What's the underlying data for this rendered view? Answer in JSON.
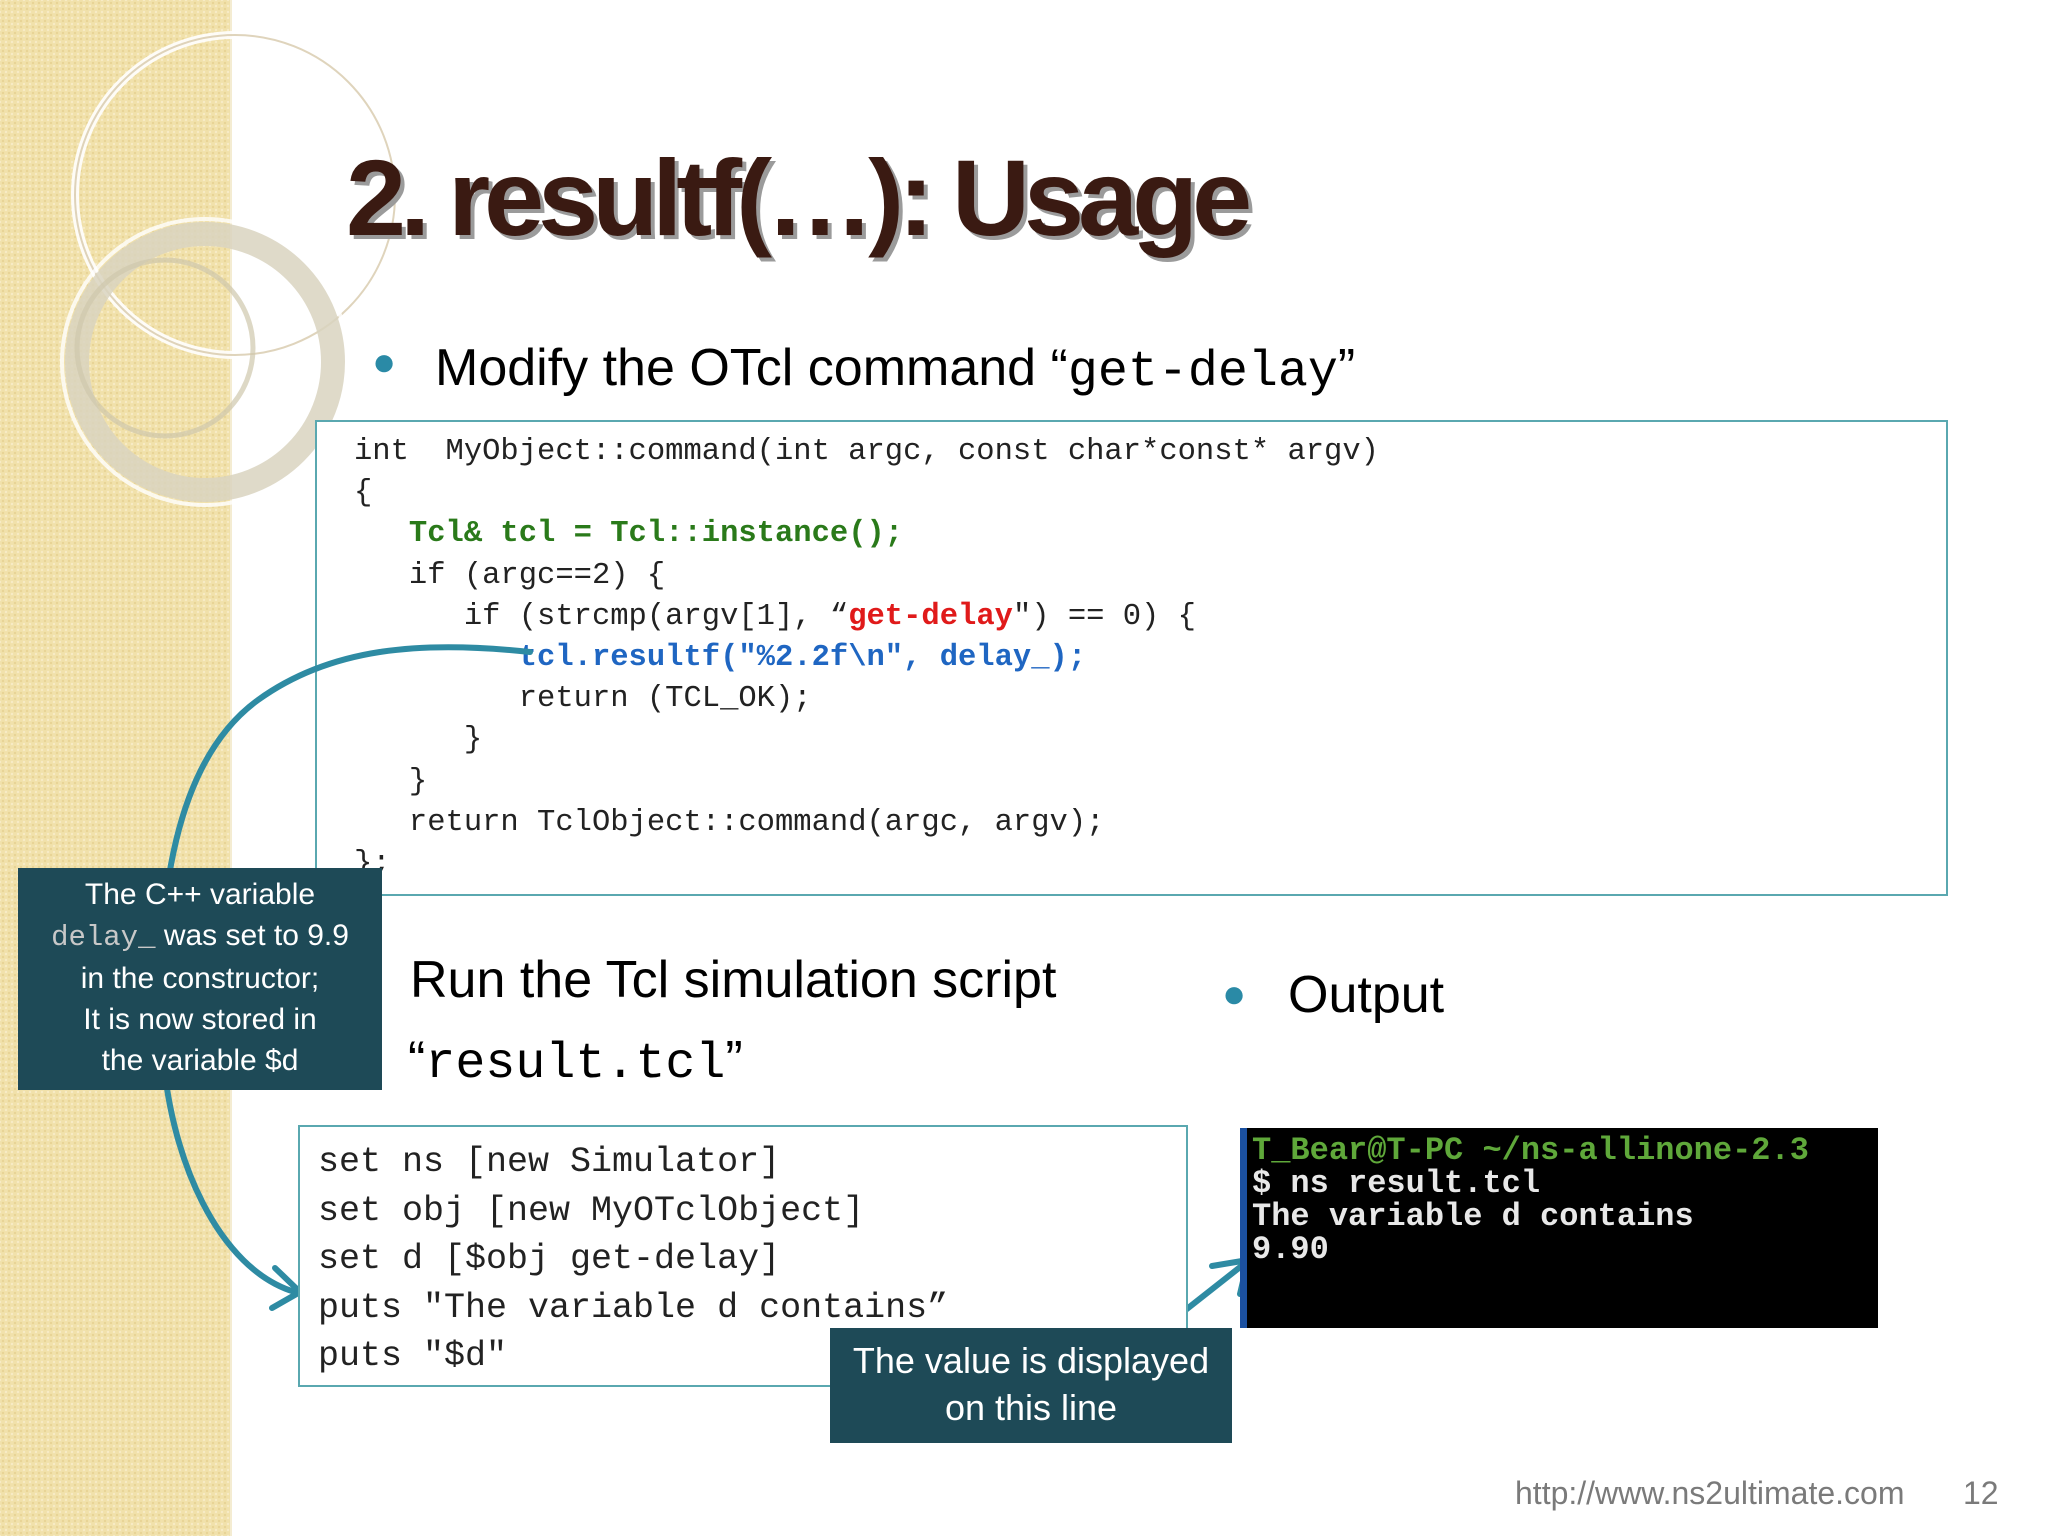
{
  "title": "2. resultf(…): Usage",
  "bullet1": {
    "text": "Modify the OTcl command “",
    "code": "get-delay",
    "close": "”"
  },
  "code_block": {
    "line1": "int  MyObject::command(int argc, const char*const* argv)",
    "line2": "{",
    "line3_green": "Tcl& tcl = Tcl::instance();",
    "line4": "if (argc==2) {",
    "line5_pre": "if (strcmp(argv[1], “",
    "line5_red": "get-delay",
    "line5_post": "\") == 0) {",
    "line6_blue": "tcl.resultf(\"%2.2f\\n\", delay_);",
    "line7": "return (TCL_OK);",
    "line8": "}",
    "line9": "}",
    "line10": "return TclObject::command(argc, argv);",
    "line11": "};"
  },
  "callout_left": {
    "line1": "The C++ variable",
    "line2_code": "delay_",
    "line2_text": " was set to 9.9",
    "line3": "in the constructor;",
    "line4": "It is now stored in",
    "line5": "the variable $d"
  },
  "run_heading": {
    "line1": "Run the Tcl simulation script",
    "open_quote": "“",
    "code": "result.tcl",
    "close_quote": "”"
  },
  "output_heading": "Output",
  "script": {
    "line1": "set ns [new Simulator]",
    "line2": "set obj [new MyOTclObject]",
    "line3": "set d [$obj get-delay]",
    "line4": "puts \"The variable d contains”",
    "line5": "puts \"$d\""
  },
  "callout_bottom": {
    "line1": "The value is displayed",
    "line2": "on this line"
  },
  "terminal": {
    "prompt": "T_Bear@T-PC ~/ns-allinone-2.3",
    "command": "$ ns result.tcl",
    "out1": "The variable d contains",
    "out2": "9.90"
  },
  "footer": {
    "url": "http://www.ns2ultimate.com",
    "page": "12"
  },
  "colors": {
    "title": "#3a1a12",
    "accent": "#2a8aa6",
    "callout_bg": "#1e4a57",
    "code_green": "#2a7a1a",
    "code_red": "#e01a1a",
    "code_blue": "#1f66c2",
    "terminal_prompt": "#5fa83a"
  }
}
